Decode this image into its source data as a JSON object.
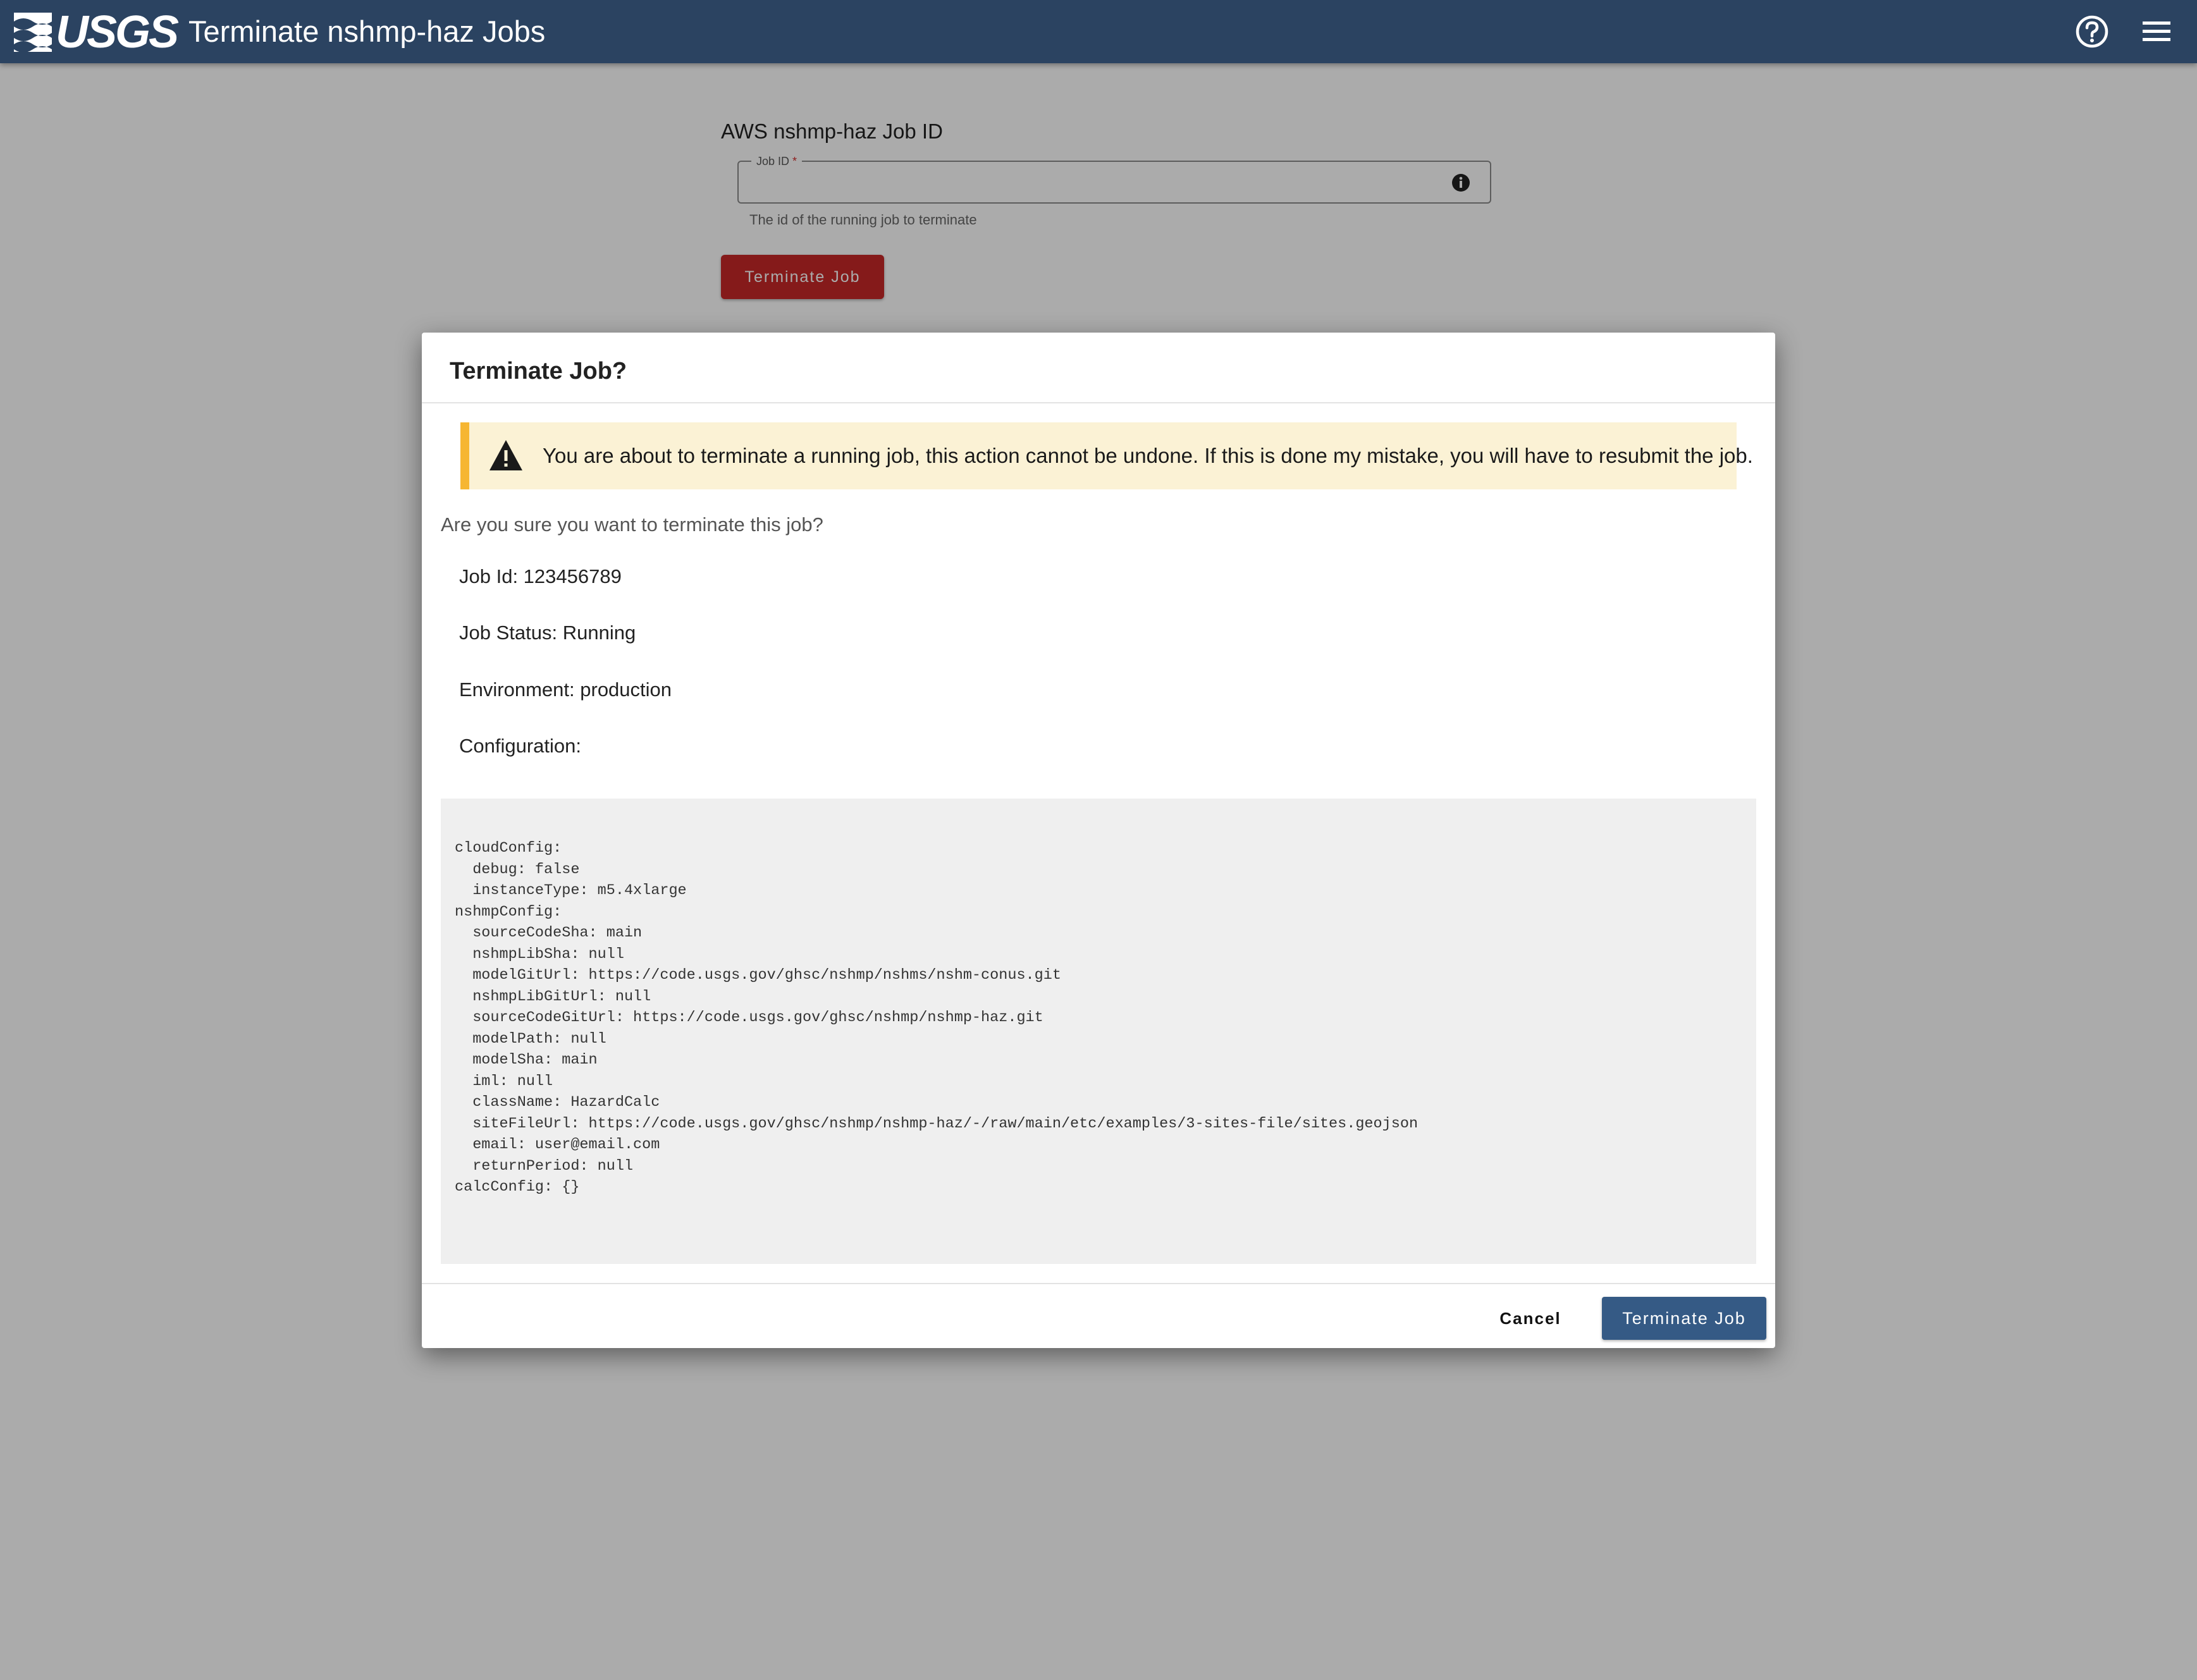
{
  "header": {
    "logo_text": "USGS",
    "title": "Terminate nshmp-haz Jobs",
    "help_icon": "help-circle-icon",
    "menu_icon": "hamburger-menu-icon",
    "background": "#2b4361"
  },
  "form": {
    "title": "AWS nshmp-haz Job ID",
    "job_id_label": "Job ID",
    "required_marker": "*",
    "job_id_value": "",
    "job_id_help": "The id of the running job to terminate",
    "info_icon": "info-icon",
    "terminate_label": "Terminate Job",
    "terminate_color": "#c62828"
  },
  "dialog": {
    "title": "Terminate Job?",
    "warning": {
      "icon": "warning-triangle-icon",
      "text": "You are about to terminate a running job, this action cannot be undone. If this is done my mistake, you will have to resubmit the job.",
      "background": "#fbf2d5",
      "accent": "#f6b632"
    },
    "question": "Are you sure you want to terminate this job?",
    "job_id": "Job Id: 123456789",
    "job_status": "Job Status: Running",
    "environment": "Environment: production",
    "configuration_label": "Configuration:",
    "configuration": "cloudConfig:\n  debug: false\n  instanceType: m5.4xlarge\nnshmpConfig:\n  sourceCodeSha: main\n  nshmpLibSha: null\n  modelGitUrl: https://code.usgs.gov/ghsc/nshmp/nshms/nshm-conus.git\n  nshmpLibGitUrl: null\n  sourceCodeGitUrl: https://code.usgs.gov/ghsc/nshmp/nshmp-haz.git\n  modelPath: null\n  modelSha: main\n  iml: null\n  className: HazardCalc\n  siteFileUrl: https://code.usgs.gov/ghsc/nshmp/nshmp-haz/-/raw/main/etc/examples/3-sites-file/sites.geojson\n  email: user@email.com\n  returnPeriod: null\ncalcConfig: {}",
    "cancel_label": "Cancel",
    "confirm_label": "Terminate Job",
    "confirm_color": "#355a85"
  }
}
